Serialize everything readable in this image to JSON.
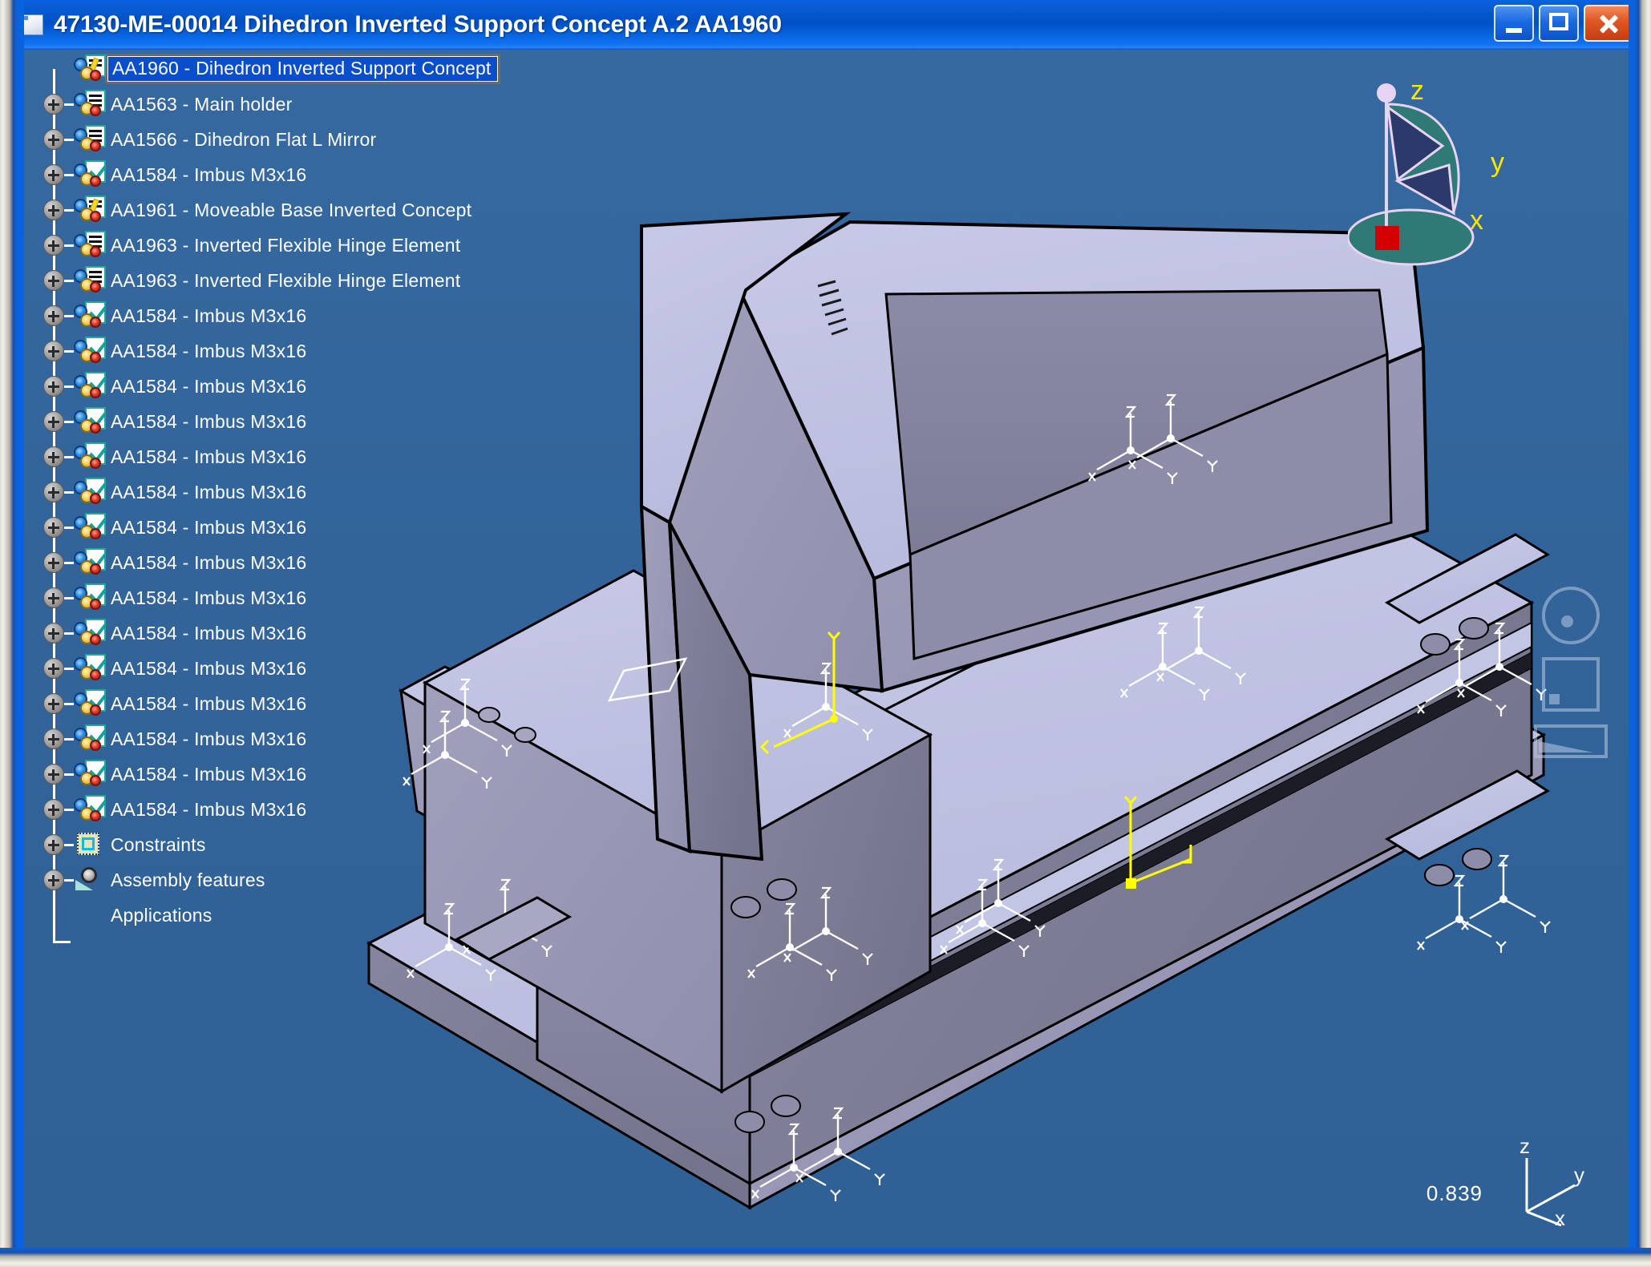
{
  "window": {
    "title": "47130-ME-00014 Dihedron Inverted Support Concept  A.2 AA1960",
    "icon": "document-icon",
    "controls": {
      "minimize": "Minimize",
      "maximize": "Maximize",
      "close": "Close"
    }
  },
  "tree": {
    "root": {
      "label": "AA1960 - Dihedron Inverted Support Concept",
      "selected": true,
      "icon": "product-pencil-icon"
    },
    "items": [
      {
        "label": "AA1563 - Main holder",
        "icon": "part-doc-icon",
        "expandable": true
      },
      {
        "label": "AA1566 - Dihedron Flat L Mirror",
        "icon": "part-doc-icon",
        "expandable": true
      },
      {
        "label": "AA1584 - Imbus M3x16",
        "icon": "part-check-icon",
        "expandable": true
      },
      {
        "label": "AA1961 - Moveable Base Inverted Concept",
        "icon": "product-pencil-icon",
        "expandable": true
      },
      {
        "label": "AA1963 - Inverted Flexible Hinge Element",
        "icon": "part-doc-icon",
        "expandable": true
      },
      {
        "label": "AA1963 - Inverted Flexible Hinge Element",
        "icon": "part-doc-icon",
        "expandable": true
      },
      {
        "label": "AA1584 - Imbus M3x16",
        "icon": "part-check-icon",
        "expandable": true
      },
      {
        "label": "AA1584 - Imbus M3x16",
        "icon": "part-check-icon",
        "expandable": true
      },
      {
        "label": "AA1584 - Imbus M3x16",
        "icon": "part-check-icon",
        "expandable": true
      },
      {
        "label": "AA1584 - Imbus M3x16",
        "icon": "part-check-icon",
        "expandable": true
      },
      {
        "label": "AA1584 - Imbus M3x16",
        "icon": "part-check-icon",
        "expandable": true
      },
      {
        "label": "AA1584 - Imbus M3x16",
        "icon": "part-check-icon",
        "expandable": true
      },
      {
        "label": "AA1584 - Imbus M3x16",
        "icon": "part-check-icon",
        "expandable": true
      },
      {
        "label": "AA1584 - Imbus M3x16",
        "icon": "part-check-icon",
        "expandable": true
      },
      {
        "label": "AA1584 - Imbus M3x16",
        "icon": "part-check-icon",
        "expandable": true
      },
      {
        "label": "AA1584 - Imbus M3x16",
        "icon": "part-check-icon",
        "expandable": true
      },
      {
        "label": "AA1584 - Imbus M3x16",
        "icon": "part-check-icon",
        "expandable": true
      },
      {
        "label": "AA1584 - Imbus M3x16",
        "icon": "part-check-icon",
        "expandable": true
      },
      {
        "label": "AA1584 - Imbus M3x16",
        "icon": "part-check-icon",
        "expandable": true
      },
      {
        "label": "AA1584 - Imbus M3x16",
        "icon": "part-check-icon",
        "expandable": true
      },
      {
        "label": "AA1584 - Imbus M3x16",
        "icon": "part-check-icon",
        "expandable": true
      },
      {
        "label": "Constraints",
        "icon": "constraints-icon",
        "expandable": true
      },
      {
        "label": "Assembly features",
        "icon": "assembly-features-icon",
        "expandable": true
      },
      {
        "label": "Applications",
        "icon": "none",
        "expandable": false
      }
    ]
  },
  "viewport": {
    "background_color": "#32659a",
    "zoom_factor": "0.839",
    "compass": {
      "x": "x",
      "y": "y",
      "z": "z"
    },
    "corner_triad": {
      "x": "x",
      "y": "y",
      "z": "z"
    },
    "model_colors": {
      "light_face": "#c3c5e4",
      "mid_face": "#9a9ab8",
      "dark_face": "#7e7e99",
      "edge": "#000000",
      "highlight_axis": "#ffff00",
      "axis_system": "#ffffff"
    }
  },
  "view_tools": [
    {
      "name": "rotate-view-icon"
    },
    {
      "name": "fit-all-view-icon"
    },
    {
      "name": "normal-view-icon"
    }
  ]
}
